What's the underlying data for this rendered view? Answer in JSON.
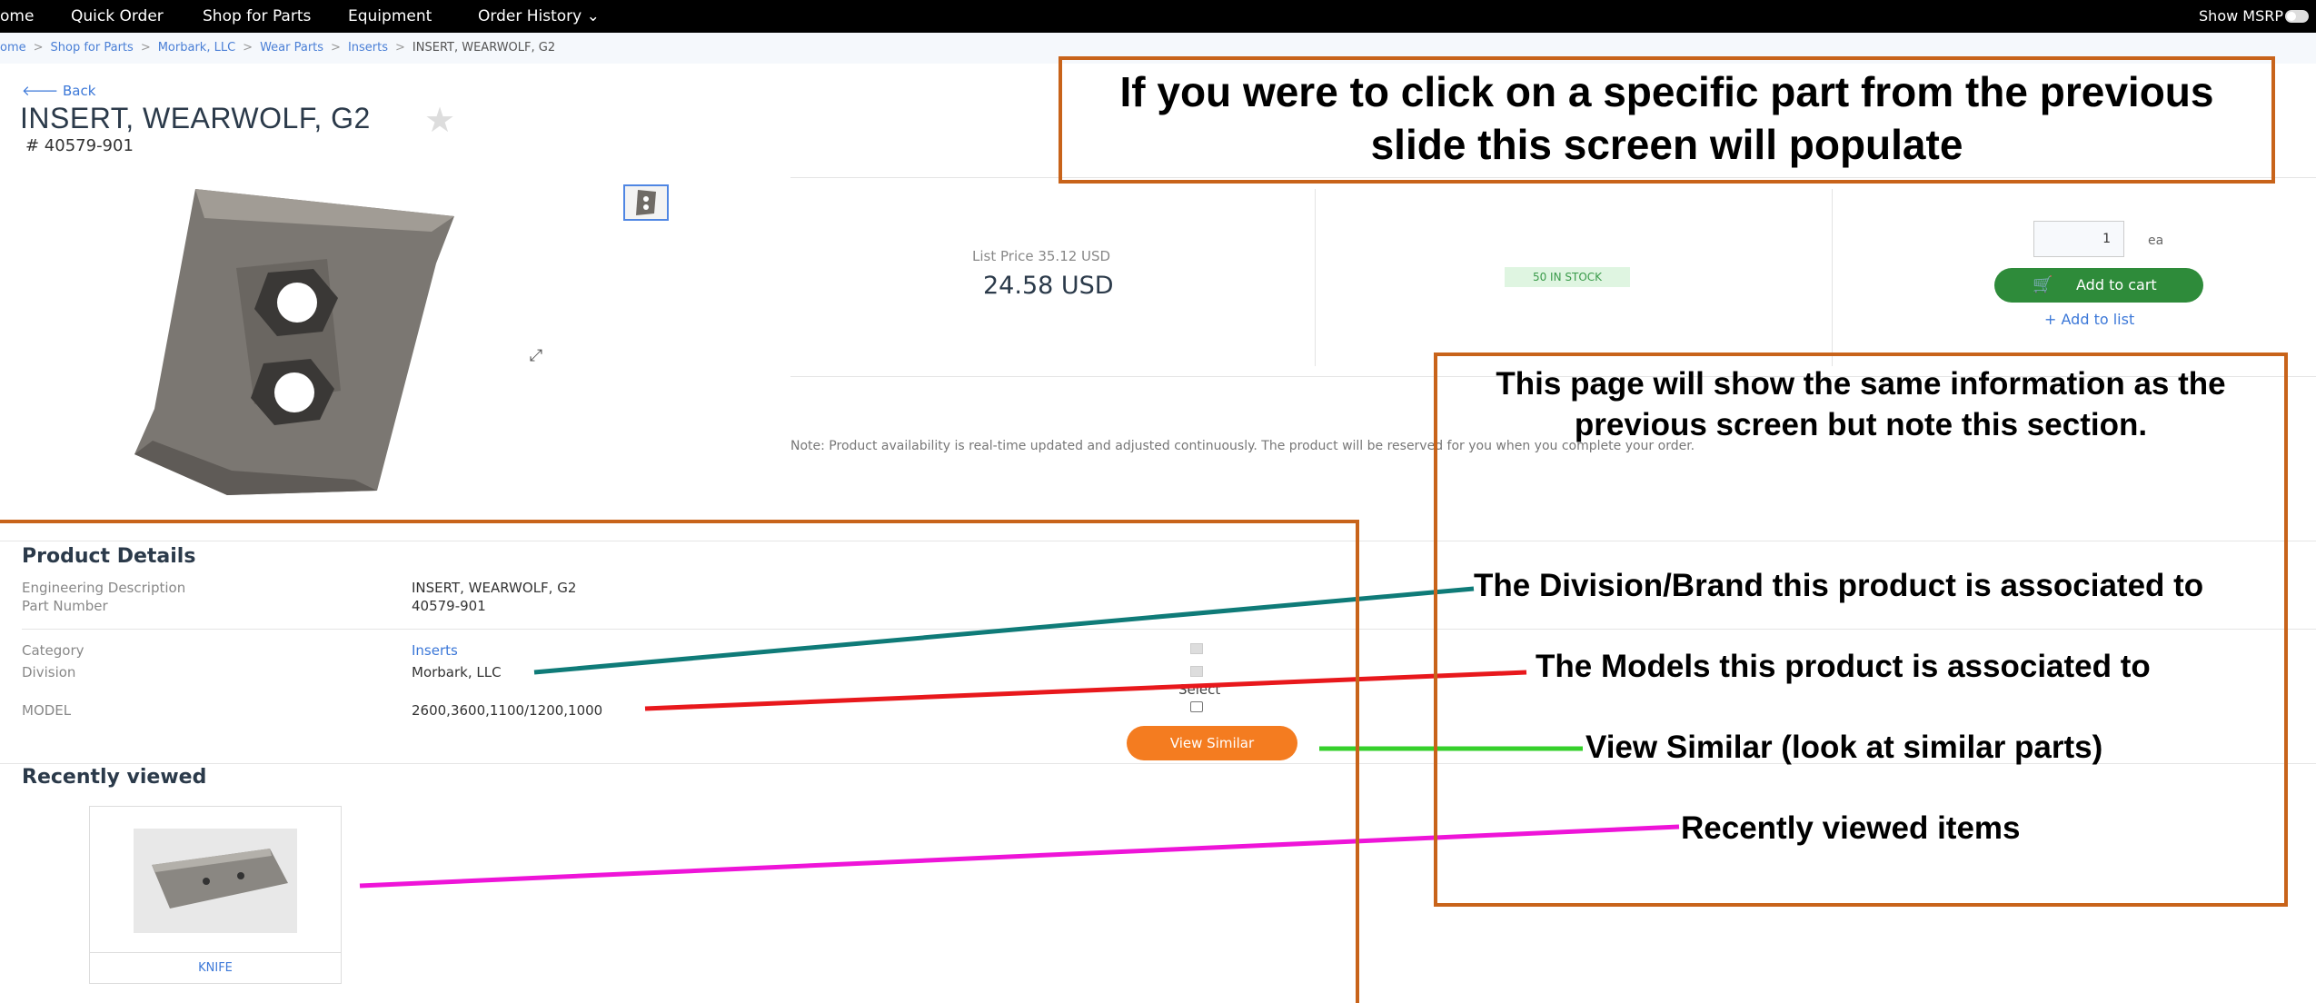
{
  "nav": {
    "items": [
      "ome",
      "Quick Order",
      "Shop for Parts",
      "Equipment",
      "Order History"
    ],
    "show_msrp": "Show MSRP"
  },
  "breadcrumb": [
    "ome",
    "Shop for Parts",
    "Morbark, LLC",
    "Wear Parts",
    "Inserts",
    "INSERT, WEARWOLF, G2"
  ],
  "product": {
    "back": "Back",
    "title": "INSERT, WEARWOLF, G2",
    "number": "# 40579-901",
    "list_price": "List Price  35.12 USD",
    "price": "24.58 USD",
    "stock": "50 IN STOCK",
    "qty": "1",
    "unit": "ea",
    "add_to_cart": "Add to cart",
    "add_to_list": "Add to list",
    "note": "Note: Product availability is real-time updated and adjusted continuously. The product will be reserved for you when you complete your order."
  },
  "details": {
    "title": "Product Details",
    "rows": [
      {
        "label": "Engineering Description",
        "value": "INSERT, WEARWOLF, G2"
      },
      {
        "label": "Part Number",
        "value": "40579-901"
      },
      {
        "label": "Category",
        "value": "Inserts"
      },
      {
        "label": "Division",
        "value": "Morbark, LLC"
      },
      {
        "label": "MODEL",
        "value": "2600,3600,1100/1200,1000"
      }
    ],
    "select_label": "Select",
    "view_similar": "View Similar"
  },
  "recently_viewed": {
    "title": "Recently viewed",
    "items": [
      {
        "caption": "KNIFE"
      }
    ]
  },
  "annotations": {
    "top": "If you were to click on a specific part from the previous slide this screen will populate",
    "section": "This page will show the same information as the previous screen but note this section.",
    "division": "The Division/Brand this product is associated to",
    "models": "The Models this product is associated to",
    "similar": "View Similar (look at similar parts)",
    "recent": "Recently viewed items"
  },
  "colors": {
    "nav_bg": "#000000",
    "link": "#3c78d8",
    "cart_green": "#2e8b3a",
    "similar_orange": "#f47c20",
    "annotation_box": "#c8631a",
    "line_division": "#0f7b78",
    "line_models": "#e8181c",
    "line_similar": "#36d02c",
    "line_recent": "#ee14d8"
  }
}
